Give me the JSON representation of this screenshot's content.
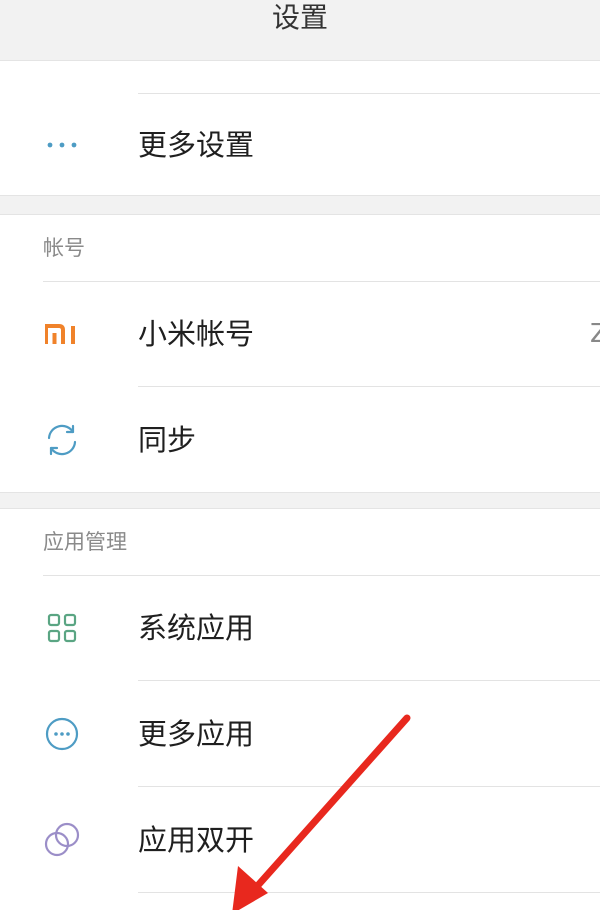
{
  "header": {
    "title": "设置"
  },
  "top_item": {
    "label": "更多设置",
    "icon": "more-dots-icon"
  },
  "sections": {
    "account": {
      "title": "帐号",
      "items": [
        {
          "label": "小米帐号",
          "value": "Z",
          "icon": "mi-logo-icon"
        },
        {
          "label": "同步",
          "icon": "sync-icon"
        }
      ]
    },
    "app_management": {
      "title": "应用管理",
      "items": [
        {
          "label": "系统应用",
          "icon": "grid-icon"
        },
        {
          "label": "更多应用",
          "icon": "more-apps-icon"
        },
        {
          "label": "应用双开",
          "icon": "dual-apps-icon"
        }
      ]
    }
  },
  "colors": {
    "accent_teal": "#4e9cc4",
    "mi_orange": "#f0822a",
    "grid_green": "#5aa583",
    "dual_purple": "#9b8ec8",
    "annotation_red": "#e8281e"
  }
}
